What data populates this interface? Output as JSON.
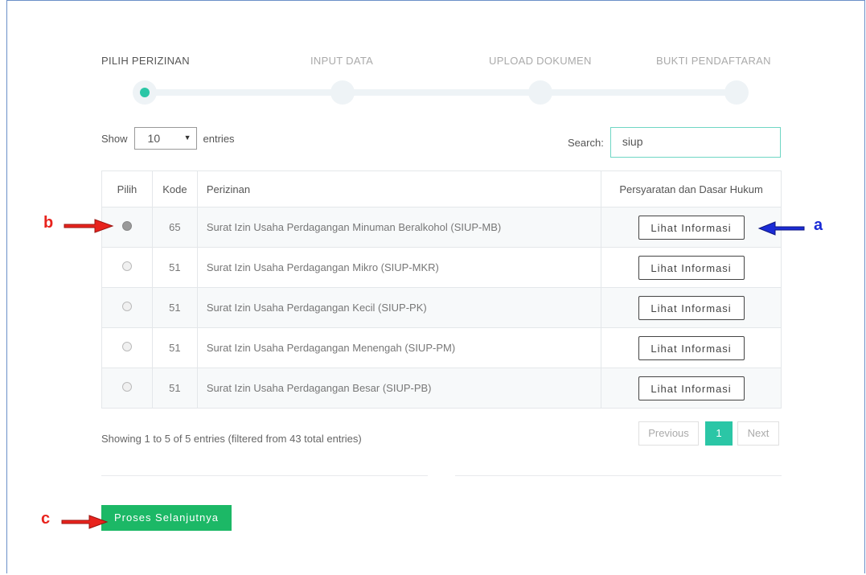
{
  "wizard": {
    "steps": [
      "PILIH PERIZINAN",
      "INPUT DATA",
      "UPLOAD DOKUMEN",
      "BUKTI PENDAFTARAN"
    ],
    "active_index": 0
  },
  "controls": {
    "show_label": "Show",
    "entries_value": "10",
    "entries_label": "entries",
    "search_label": "Search:",
    "search_value": "siup"
  },
  "table": {
    "headers": [
      "Pilih",
      "Kode",
      "Perizinan",
      "Persyaratan dan Dasar Hukum"
    ],
    "button_label": "Lihat Informasi",
    "rows": [
      {
        "kode": "65",
        "perizinan": "Surat Izin Usaha Perdagangan Minuman Beralkohol (SIUP-MB)",
        "selected": true
      },
      {
        "kode": "51",
        "perizinan": "Surat Izin Usaha Perdagangan Mikro (SIUP-MKR)",
        "selected": false
      },
      {
        "kode": "51",
        "perizinan": "Surat Izin Usaha Perdagangan Kecil (SIUP-PK)",
        "selected": false
      },
      {
        "kode": "51",
        "perizinan": "Surat Izin Usaha Perdagangan Menengah (SIUP-PM)",
        "selected": false
      },
      {
        "kode": "51",
        "perizinan": "Surat Izin Usaha Perdagangan Besar (SIUP-PB)",
        "selected": false
      }
    ]
  },
  "footer": {
    "info": "Showing 1 to 5 of 5 entries (filtered from 43 total entries)",
    "previous": "Previous",
    "page": "1",
    "next": "Next",
    "proceed": "Proses Selanjutnya"
  },
  "annotations": {
    "a": "a",
    "b": "b",
    "c": "c"
  },
  "colors": {
    "accent": "#2bc6a6",
    "proceed": "#1cb866",
    "arrow_red": "#e8231d",
    "arrow_blue": "#1a2bd6"
  }
}
